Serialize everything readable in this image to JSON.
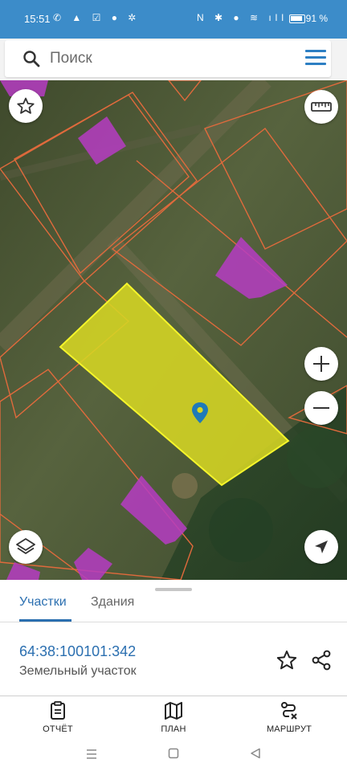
{
  "status_bar": {
    "time": "15:51",
    "battery": "91 %",
    "left_icons": [
      "whatsapp-icon",
      "app-icon",
      "check-icon",
      "alert-icon",
      "settings-icon"
    ],
    "right_icons": [
      "nfc-icon",
      "bluetooth-icon",
      "location-icon",
      "wifi-icon",
      "signal-icon",
      "battery-icon"
    ]
  },
  "search": {
    "placeholder": "Поиск"
  },
  "map": {
    "selected_parcel_color": "#d6d623",
    "building_color": "#b63cc3",
    "boundary_color": "#e06a3c",
    "marker_color": "#1f7ab8",
    "buttons": [
      "favorite-icon",
      "ruler-icon",
      "zoom-in-icon",
      "zoom-out-icon",
      "layers-icon",
      "locate-icon"
    ]
  },
  "sheet": {
    "tabs": [
      {
        "label": "Участки",
        "active": true
      },
      {
        "label": "Здания",
        "active": false
      }
    ],
    "parcel_id": "64:38:100101:342",
    "parcel_type": "Земельный участок"
  },
  "bottom_nav": {
    "items": [
      {
        "label": "ОТЧЁТ",
        "icon": "report-icon"
      },
      {
        "label": "ПЛАН",
        "icon": "map-plan-icon"
      },
      {
        "label": "МАРШРУТ",
        "icon": "route-icon"
      }
    ]
  },
  "colors": {
    "accent": "#2b6fb0",
    "status_bar": "#3c8cc9"
  }
}
